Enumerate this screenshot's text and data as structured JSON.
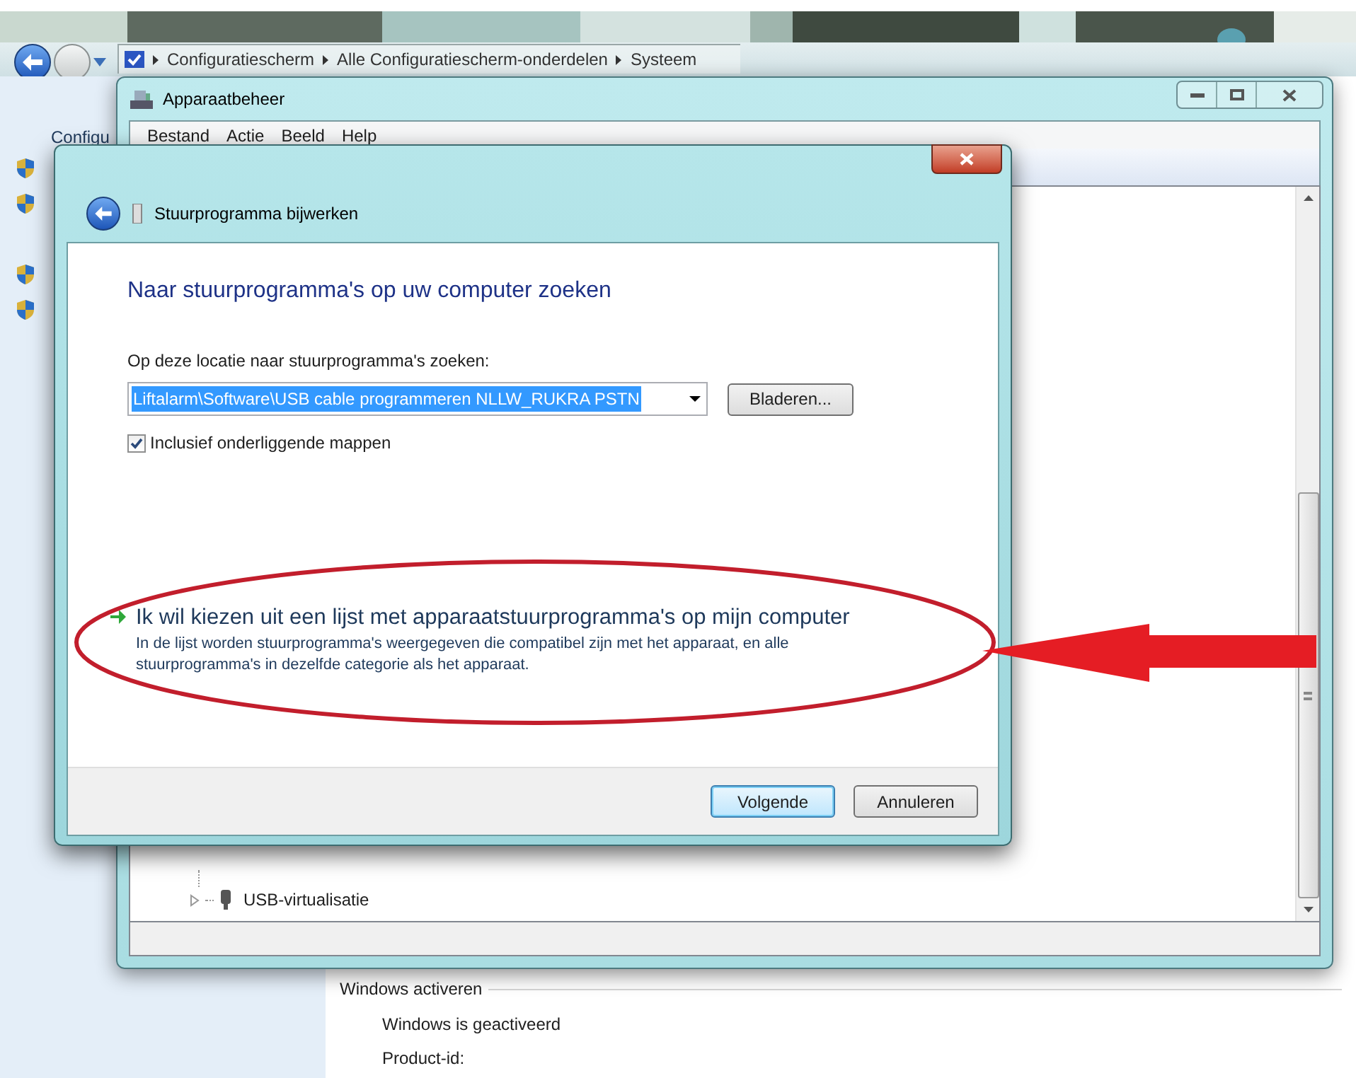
{
  "explorer": {
    "breadcrumb": [
      "Configuratiescherm",
      "Alle Configuratiescherm-onderdelen",
      "Systeem"
    ],
    "sidebar_heading": "Configu",
    "activation": {
      "heading": "Windows activeren",
      "status": "Windows is geactiveerd",
      "product_id_label": "Product-id:"
    }
  },
  "device_manager": {
    "title": "Apparaatbeheer",
    "menu": [
      "Bestand",
      "Actie",
      "Beeld",
      "Help"
    ],
    "tree": [
      {
        "label": "USB-virtualisatie",
        "expanded": false
      }
    ]
  },
  "dialog": {
    "title": "Stuurprogramma bijwerken",
    "heading": "Naar stuurprogramma's op uw computer zoeken",
    "path_label": "Op deze locatie naar stuurprogramma's zoeken:",
    "path_value": "Liftalarm\\Software\\USB cable programmeren NLLW_RUKRA PSTN",
    "browse_button": "Bladeren...",
    "include_subfolders": {
      "label": "Inclusief onderliggende mappen",
      "checked": true
    },
    "option": {
      "title": "Ik wil kiezen uit een lijst met apparaatstuurprogramma's op mijn computer",
      "description": "In de lijst worden stuurprogramma's weergegeven die compatibel zijn met het apparaat, en alle stuurprogramma's in dezelfde categorie als het apparaat."
    },
    "buttons": [
      {
        "label": "Volgende",
        "default": true
      },
      {
        "label": "Annuleren",
        "default": false
      }
    ]
  }
}
